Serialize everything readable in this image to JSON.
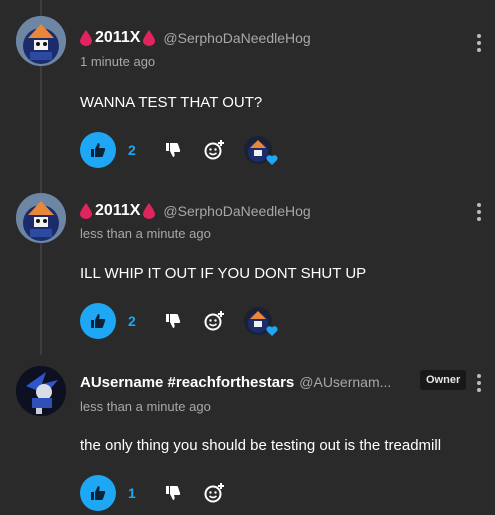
{
  "comments": [
    {
      "display_name": "2011X",
      "handle": "@SerphoDaNeedleHog",
      "time": "1 minute ago",
      "text": "WANNA TEST THAT OUT?",
      "likes": "2",
      "has_reactor": true
    },
    {
      "display_name": "2011X",
      "handle": "@SerphoDaNeedleHog",
      "time": "less than a minute ago",
      "text": "ILL WHIP IT OUT IF YOU DONT SHUT UP",
      "likes": "2",
      "has_reactor": true
    },
    {
      "display_name": "AUsername #reachforthestars",
      "handle": "@AUsernam...",
      "badge": "Owner",
      "time": "less than a minute ago",
      "text": "the only thing you should be testing out is the treadmill",
      "likes": "1",
      "has_reactor": false
    }
  ],
  "colors": {
    "accent": "#1ea7f5",
    "drop": "#e0245e",
    "background": "#2a2a2a"
  },
  "icons": [
    "blood-drop-icon",
    "thumbs-up-icon",
    "thumbs-down-icon",
    "add-reaction-icon",
    "heart-icon",
    "more-options-icon"
  ]
}
